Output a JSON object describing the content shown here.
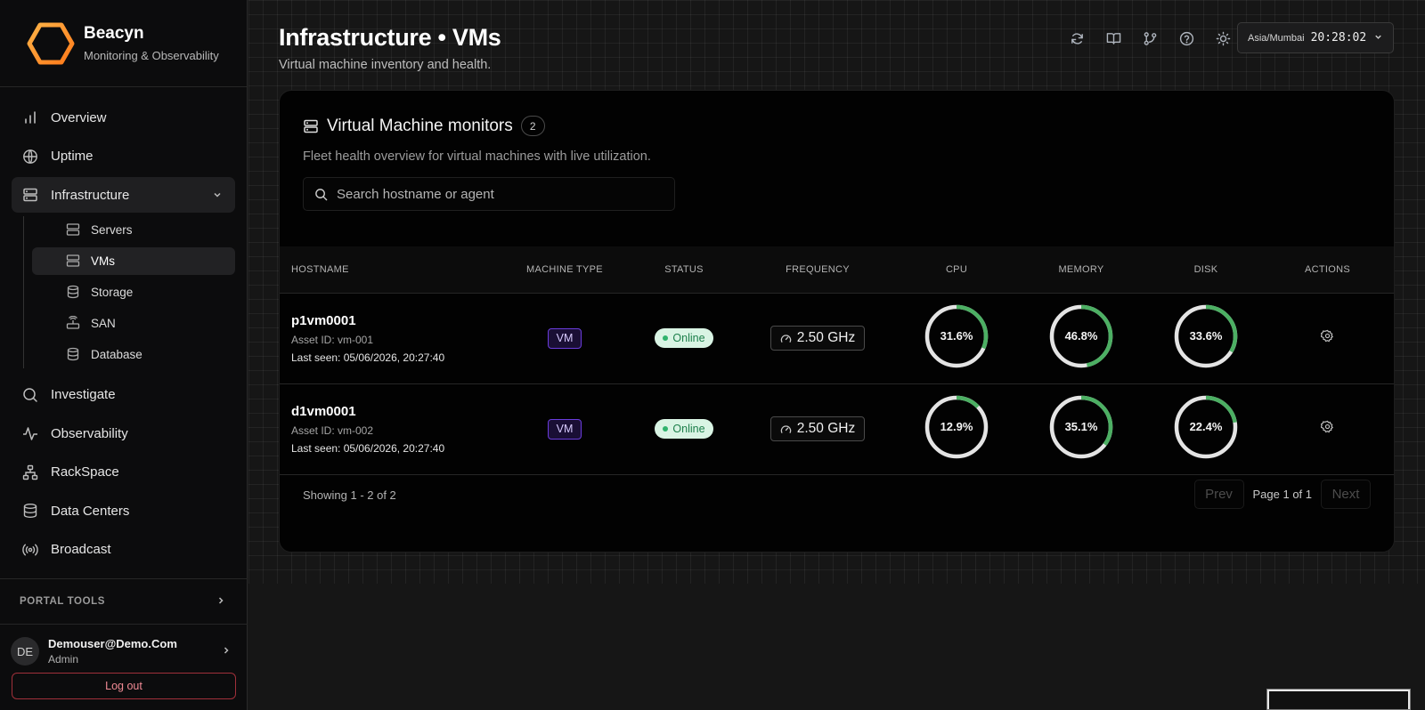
{
  "brand": {
    "name": "Beacyn",
    "tagline": "Monitoring & Observability"
  },
  "nav": {
    "overview": "Overview",
    "uptime": "Uptime",
    "infrastructure": "Infrastructure",
    "sub": {
      "servers": "Servers",
      "vms": "VMs",
      "storage": "Storage",
      "san": "SAN",
      "database": "Database"
    },
    "investigate": "Investigate",
    "observability": "Observability",
    "rackspace": "RackSpace",
    "datacenters": "Data Centers",
    "broadcast": "Broadcast"
  },
  "portal_tools": "PORTAL TOOLS",
  "user": {
    "initials": "DE",
    "email": "Demouser@Demo.Com",
    "role": "Admin"
  },
  "logout": "Log out",
  "header": {
    "title": "Infrastructure • VMs",
    "subtitle": "Virtual machine inventory and health.",
    "timezone": "Asia/Mumbai",
    "time": "20:28:02"
  },
  "card": {
    "title": "Virtual Machine monitors",
    "count": "2",
    "subtitle": "Fleet health overview for virtual machines with live utilization.",
    "search_placeholder": "Search hostname or agent"
  },
  "columns": {
    "hostname": "HOSTNAME",
    "type": "MACHINE TYPE",
    "status": "STATUS",
    "frequency": "FREQUENCY",
    "cpu": "CPU",
    "memory": "MEMORY",
    "disk": "DISK",
    "actions": "ACTIONS"
  },
  "rows": [
    {
      "hostname": "p1vm0001",
      "asset": "Asset ID: vm-001",
      "seen": "Last seen: 05/06/2026, 20:27:40",
      "type": "VM",
      "status": "Online",
      "frequency": "2.50 GHz",
      "cpu": 31.6,
      "cpu_label": "31.6%",
      "memory": 46.8,
      "memory_label": "46.8%",
      "disk": 33.6,
      "disk_label": "33.6%"
    },
    {
      "hostname": "d1vm0001",
      "asset": "Asset ID: vm-002",
      "seen": "Last seen: 05/06/2026, 20:27:40",
      "type": "VM",
      "status": "Online",
      "frequency": "2.50 GHz",
      "cpu": 12.9,
      "cpu_label": "12.9%",
      "memory": 35.1,
      "memory_label": "35.1%",
      "disk": 22.4,
      "disk_label": "22.4%"
    }
  ],
  "footer": {
    "showing": "Showing 1 - 2 of 2",
    "prev": "Prev",
    "page": "Page 1 of 1",
    "next": "Next"
  },
  "colors": {
    "ring_fill": "#4caf63",
    "ring_track": "#e4e4e4",
    "vm_badge": "#6a3cdc",
    "status_bg": "#d9f4e4"
  }
}
